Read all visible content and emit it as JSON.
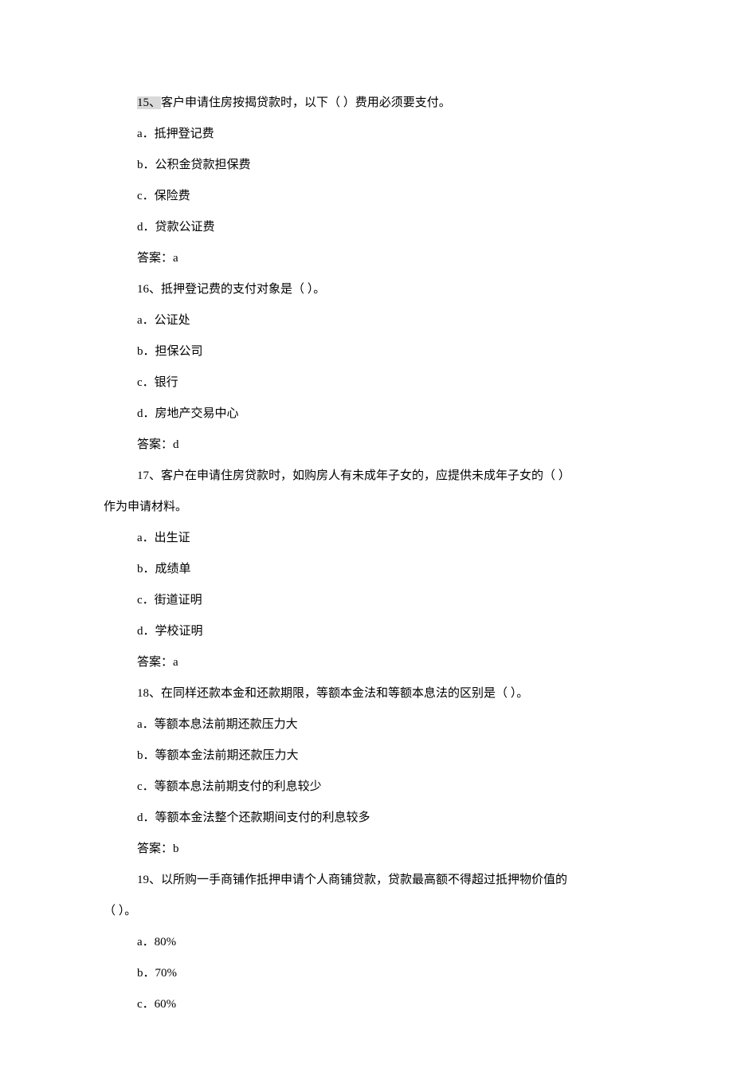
{
  "q15": {
    "num": "15、",
    "stem_after": "客户申请住房按揭贷款时，以下（   ）费用必须要支付。",
    "a": "a．抵押登记费",
    "b": "b．公积金贷款担保费",
    "c": "c．保险费",
    "d": "d．贷款公证费",
    "ans": "答案：a"
  },
  "q16": {
    "stem": "16、抵押登记费的支付对象是（    ）。",
    "a": "a．公证处",
    "b": "b．担保公司",
    "c": "c．银行",
    "d": "d．房地产交易中心",
    "ans": "答案：d"
  },
  "q17": {
    "stem_l1": "17、客户在申请住房贷款时，如购房人有未成年子女的，应提供未成年子女的（    ）",
    "stem_l2": "作为申请材料。",
    "a": "a．出生证",
    "b": "b．成绩单",
    "c": "c．街道证明",
    "d": "d．学校证明",
    "ans": "答案：a"
  },
  "q18": {
    "stem": "18、在同样还款本金和还款期限，等额本金法和等额本息法的区别是（    ）。",
    "a": "a．等额本息法前期还款压力大",
    "b": "b．等额本金法前期还款压力大",
    "c": "c．等额本息法前期支付的利息较少",
    "d": "d．等额本金法整个还款期间支付的利息较多",
    "ans": "答案：b"
  },
  "q19": {
    "stem_l1": "19、以所购一手商铺作抵押申请个人商铺贷款，贷款最高额不得超过抵押物价值的",
    "stem_l2": "（     ）。",
    "a": "a．80%",
    "b": "b．70%",
    "c": "c．60%"
  }
}
